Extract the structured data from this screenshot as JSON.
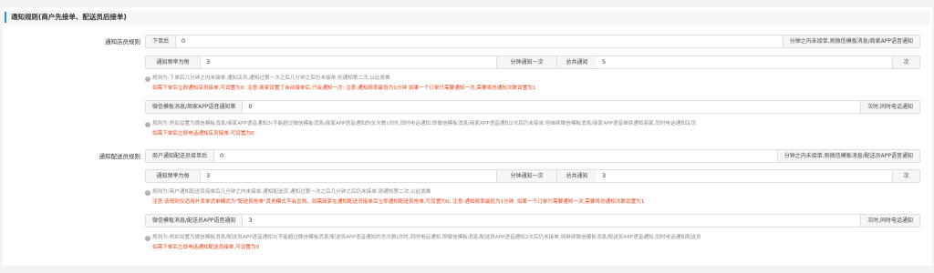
{
  "section": {
    "title": "通知规则(商户先接单、配送员后接单)"
  },
  "store": {
    "label": "通知店员规则",
    "row1": {
      "prefix": "下单后",
      "value": "0",
      "suffix": "分钟之内未接单,则微信模板消息/商家APP语音通知"
    },
    "row2": {
      "freq_label": "通知频率为每",
      "freq_value": "3",
      "mid_label": "分钟通知一次",
      "total_label": "总共通知",
      "total_value": "5",
      "suffix": "次"
    },
    "hint1": "规则为:下单后几分钟之内未接单,通知店员,通知过第一次之后几分钟之后仍未接单,则通知第二次,以此类推",
    "warn1": "如需下单后立即通知店员接单,可设置为0; 注意:商家设置了自动接单后,只会通知一次; 注意:通知频率最低为1分钟 如果一个订单只需要通知一次,需要将总通知次数设置为1",
    "row3": {
      "prefix": "微信模板消息/商家APP语音通知第",
      "value": "0",
      "suffix": "次时,同时电话通知"
    },
    "hint2": "规则为:例如设置为微信模板消息/商家APP语音通知3(不能超过微信模板消息/商家APP语音通知的总次数)次时,同时电话通知,即微信模板消息/商家APP语音通知2次后仍未接单,则继续微信模板消息/商家APP语音继续通知商家,同时电话通知店员",
    "warn2": "如需下单后立即电话通知店员接单,可设置为0"
  },
  "courier": {
    "label": "通知配送员规则",
    "row1": {
      "prefix": "商户通知配送员接单后",
      "value": "0",
      "suffix": "分钟之内未接单,则微信模板消息/配送员APP语音通知"
    },
    "row2": {
      "freq_label": "通知频率为每",
      "freq_value": "3",
      "mid_label": "分钟通知一次",
      "total_label": "总共通知",
      "total_value": "3",
      "suffix": "次"
    },
    "hint1": "规则为:商户通知配送员接单后几分钟之内未接单,通知配送员,通知过第一次之后几分钟之后仍未接单,则通知第二次,以此类推",
    "warn1": "注意:该规则仅适用外卖单消单模式为\"配送员抢单\"其他模式不会生效。如需商家在通知配送员接单后立即通知配送员抢单,可设置为0; 注意:通知频率最低为1分钟, 如果一个订单只需要通知一次,需要将总通知次数设置为1",
    "row3": {
      "prefix": "微信模板消息/配送员APP语音通知",
      "value": "3",
      "suffix": "次时,同时电话通知"
    },
    "hint2": "规则为:例如设置为微信模板消息/配送员APP语音通知3(不能超过微信模板消息/配送员APP语音通知的总次数)次时,同时电话通知,即微信模板消息/配送员APP语音通知2次后仍未接单,则继续微信模板消息/配送员APP语音通知,同时电话通知配送员",
    "warn2": "如需下单后立即电话通知配送员接单,可设置为0"
  }
}
